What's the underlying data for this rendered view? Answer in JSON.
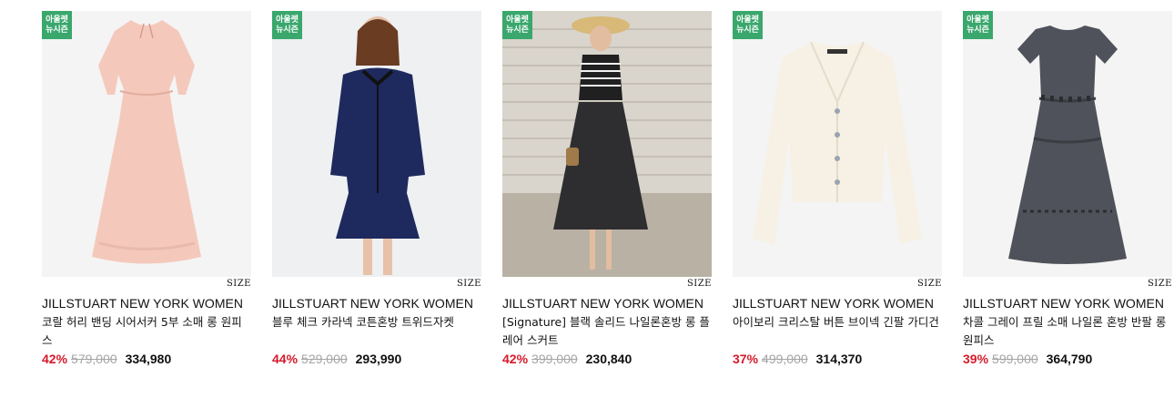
{
  "badge": {
    "line1": "아울렛",
    "line2": "뉴시즌"
  },
  "size_label": "SIZE",
  "products": [
    {
      "brand": "JILLSTUART NEW YORK WOMEN",
      "title": "코랄 허리 밴딩 시어서커 5부 소매 롱 원피스",
      "discount": "42%",
      "original_price": "579,000",
      "sale_price": "334,980",
      "badge": true
    },
    {
      "brand": "JILLSTUART NEW YORK WOMEN",
      "title": "블루 체크 카라넥 코튼혼방 트위드자켓",
      "discount": "44%",
      "original_price": "529,000",
      "sale_price": "293,990",
      "badge": true
    },
    {
      "brand": "JILLSTUART NEW YORK WOMEN",
      "title": "[Signature] 블랙 솔리드 나일론혼방 롱 플레어 스커트",
      "discount": "42%",
      "original_price": "399,000",
      "sale_price": "230,840",
      "badge": true
    },
    {
      "brand": "JILLSTUART NEW YORK WOMEN",
      "title": "아이보리 크리스탈 버튼 브이넥 긴팔 가디건",
      "discount": "37%",
      "original_price": "499,000",
      "sale_price": "314,370",
      "badge": true
    },
    {
      "brand": "JILLSTUART NEW YORK WOMEN",
      "title": "차콜 그레이 프릴 소매 나일론 혼방 반팔 롱원피스",
      "discount": "39%",
      "original_price": "599,000",
      "sale_price": "364,790",
      "badge": true
    }
  ],
  "colors": {
    "badge": "#3aa76d",
    "discount": "#d61a2b",
    "original_price": "#a5a5a5"
  }
}
